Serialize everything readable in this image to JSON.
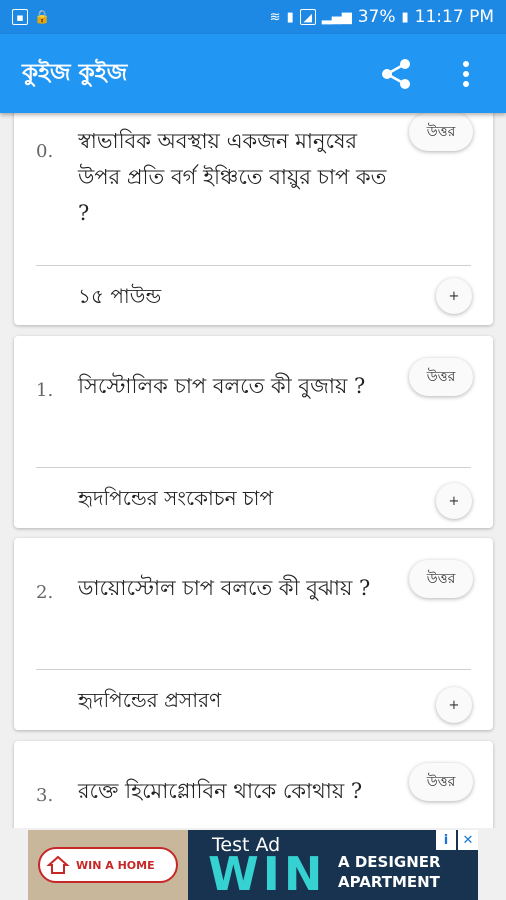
{
  "status_bar": {
    "battery": "37%",
    "time": "11:17 PM",
    "left_icons": [
      "gallery-icon",
      "lock-icon"
    ],
    "right_icons": [
      "wifi-icon",
      "sim-icon",
      "signal-icon",
      "signal-bars-icon",
      "battery-icon"
    ]
  },
  "app_bar": {
    "title": "কুইজ কুইজ",
    "actions": [
      "share-icon",
      "more-vert-icon"
    ],
    "color": "#2196f3"
  },
  "questions": [
    {
      "number": "0.",
      "question": "স্বাভাবিক অবস্থায় একজন মানুষের উপর প্রতি বর্গ ইঞ্চিতে বায়ুর চাপ কত ?",
      "answer_button": "উত্তর",
      "answer": "১৫ পাউন্ড",
      "expand_button": "+"
    },
    {
      "number": "1.",
      "question": "সিস্টোলিক চাপ বলতে কী বুজায় ?",
      "answer_button": "উত্তর",
      "answer": "হৃদপিন্ডের সংকোচন চাপ",
      "expand_button": "+"
    },
    {
      "number": "2.",
      "question": "ডায়োস্টোল চাপ বলতে কী বুঝায় ?",
      "answer_button": "উত্তর",
      "answer": "হৃদপিন্ডের প্রসারণ",
      "expand_button": "+"
    },
    {
      "number": "3.",
      "question": "রক্তে হিমোগ্লোবিন থাকে কোথায় ?",
      "answer_button": "উত্তর"
    }
  ],
  "ad": {
    "label": "Test Ad",
    "logo_text": "WIN A HOME",
    "headline": "WIN",
    "tagline_1": "A DESIGNER",
    "tagline_2": "APARTMENT",
    "info_badge": "i",
    "close_badge": "✕"
  }
}
